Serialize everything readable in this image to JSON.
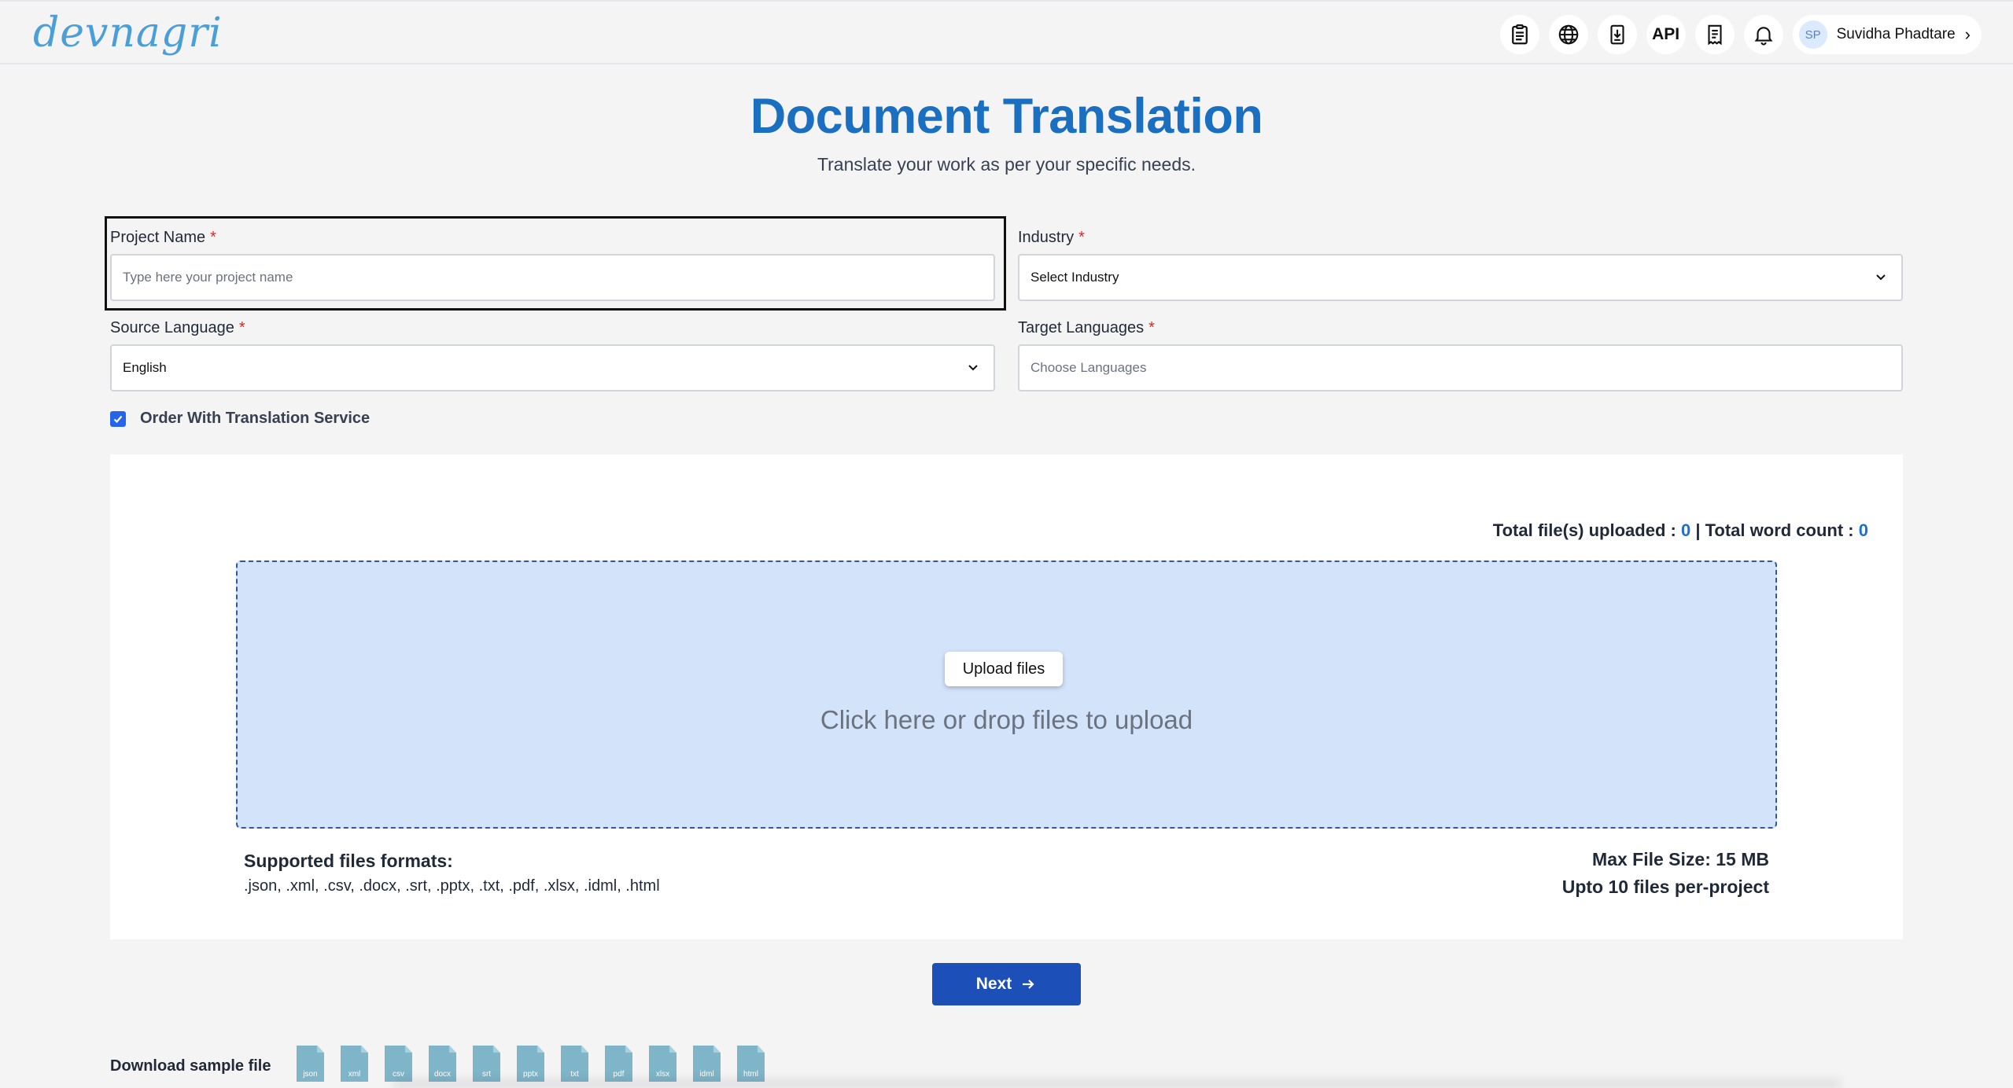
{
  "header": {
    "logo_text": "devnagri",
    "icons": [
      "clipboard-icon",
      "globe-icon",
      "document-download-icon",
      "api-icon",
      "receipt-icon",
      "bell-icon"
    ],
    "api_label": "API",
    "user": {
      "initials": "SP",
      "name": "Suvidha Phadtare"
    }
  },
  "page": {
    "title": "Document Translation",
    "subtitle": "Translate your work as per your specific needs."
  },
  "form": {
    "project_name": {
      "label": "Project Name",
      "required": "*",
      "placeholder": "Type here your project name",
      "value": ""
    },
    "industry": {
      "label": "Industry",
      "required": "*",
      "selected": "Select Industry"
    },
    "source_language": {
      "label": "Source Language",
      "required": "*",
      "selected": "English"
    },
    "target_languages": {
      "label": "Target Languages",
      "required": "*",
      "placeholder": "Choose Languages"
    },
    "order_service": {
      "label": "Order With Translation Service",
      "checked": true
    }
  },
  "upload": {
    "total_files_label": "Total file(s) uploaded :",
    "total_files_value": "0",
    "separator": "|",
    "total_words_label": "Total word count :",
    "total_words_value": "0",
    "upload_button": "Upload files",
    "drop_text": "Click here or drop files to upload",
    "formats_title": "Supported files formats:",
    "formats_list": ".json, .xml, .csv, .docx, .srt, .pptx, .txt, .pdf, .xlsx, .idml, .html",
    "max_size": "Max File Size: 15 MB",
    "max_files": "Upto 10 files per-project"
  },
  "actions": {
    "next_label": "Next"
  },
  "samples": {
    "label": "Download sample file",
    "files": [
      "json",
      "xml",
      "csv",
      "docx",
      "srt",
      "pptx",
      "txt",
      "pdf",
      "xlsx",
      "idml",
      "html"
    ]
  },
  "colors": {
    "title_blue": "#1a6fc0",
    "primary_button": "#1d4fb8",
    "dropzone_bg": "#d3e3fa",
    "required_red": "#dc2626",
    "count_blue": "#1d6fd1"
  }
}
